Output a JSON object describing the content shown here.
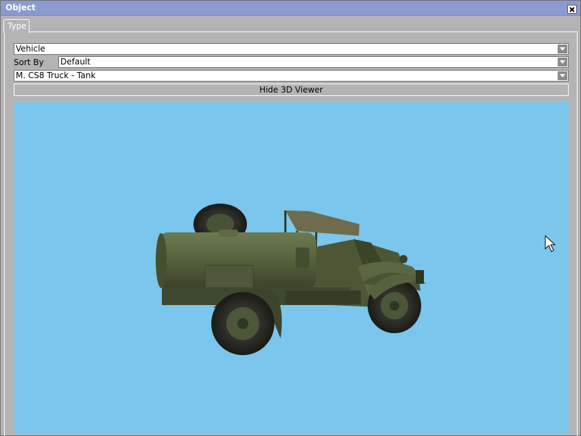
{
  "window": {
    "title": "Object"
  },
  "tabs": [
    {
      "label": "Type"
    }
  ],
  "category_select": {
    "value": "Vehicle"
  },
  "sort": {
    "label": "Sort By",
    "value": "Default"
  },
  "object_select": {
    "value": "M. CS8 Truck - Tank"
  },
  "viewer_toggle": {
    "label": "Hide 3D Viewer"
  },
  "viewer": {
    "background": "#7ac6ec",
    "model_color": "#55613c"
  },
  "colors": {
    "titlebar": "#8b9bcf",
    "window_bg": "#b4b4b4"
  }
}
